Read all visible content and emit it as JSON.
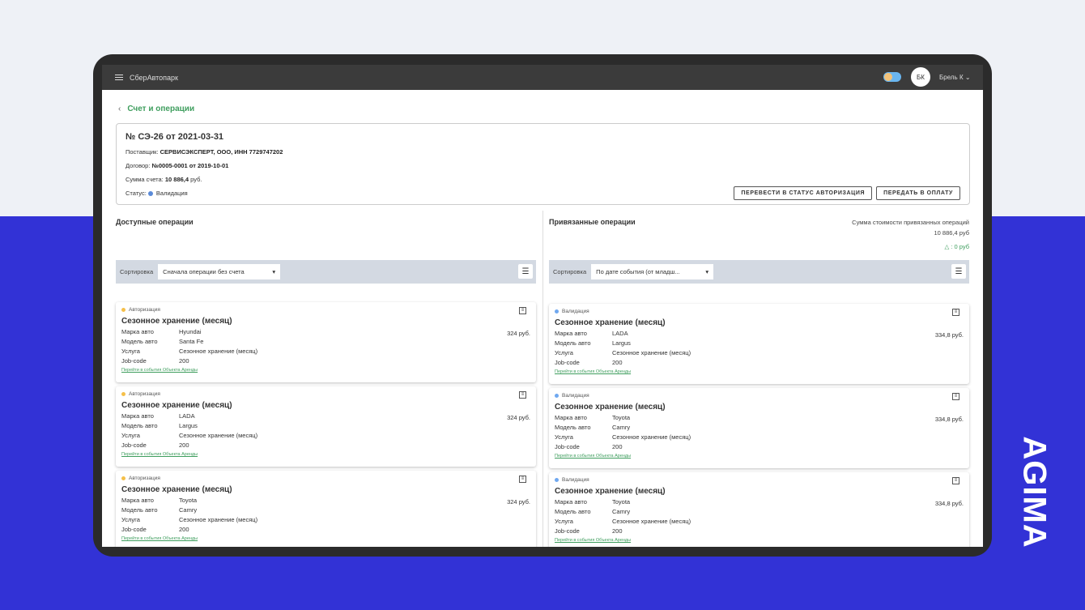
{
  "brand": "AGIMA",
  "app": {
    "title": "СберАвтопарк",
    "avatar": "БК",
    "user": "Брель К"
  },
  "back_label": "Счет и операции",
  "invoice": {
    "title": "№ СЭ-26 от 2021-03-31",
    "supplier_label": "Поставщик:",
    "supplier": "СЕРВИСЭКСПЕРТ, ООО, ИНН 7729747202",
    "contract_label": "Договор:",
    "contract": "№0005-0001 от 2019-10-01",
    "sum_label": "Сумма счета:",
    "sum": "10 886,4",
    "sum_unit": "руб.",
    "status_label": "Статус:",
    "status": "Валидация",
    "status_color": "#5a8ad8"
  },
  "buttons": {
    "authorize": "ПЕРЕВЕСТИ В СТАТУС АВТОРИЗАЦИЯ",
    "pay": "ПЕРЕДАТЬ В ОПЛАТУ"
  },
  "left": {
    "title": "Доступные операции",
    "sort_label": "Сортировка",
    "sort_value": "Сначала операции без счета",
    "cards": [
      {
        "status": "Авторизация",
        "color": "#f5c04a",
        "title": "Сезонное хранение (месяц)",
        "price": "324 руб.",
        "fields": [
          [
            "Марка авто",
            "Hyundai"
          ],
          [
            "Модель авто",
            "Santa Fe"
          ],
          [
            "Услуга",
            "Сезонное хранение (месяц)"
          ],
          [
            "Job-code",
            "200"
          ]
        ],
        "link": "Перейти в события Объекта Аренды"
      },
      {
        "status": "Авторизация",
        "color": "#f5c04a",
        "title": "Сезонное хранение (месяц)",
        "price": "324 руб.",
        "fields": [
          [
            "Марка авто",
            "LADA"
          ],
          [
            "Модель авто",
            "Largus"
          ],
          [
            "Услуга",
            "Сезонное хранение (месяц)"
          ],
          [
            "Job-code",
            "200"
          ]
        ],
        "link": "Перейти в события Объекта Аренды"
      },
      {
        "status": "Авторизация",
        "color": "#f5c04a",
        "title": "Сезонное хранение (месяц)",
        "price": "324 руб.",
        "fields": [
          [
            "Марка авто",
            "Toyota"
          ],
          [
            "Модель авто",
            "Camry"
          ],
          [
            "Услуга",
            "Сезонное хранение (месяц)"
          ],
          [
            "Job-code",
            "200"
          ]
        ],
        "link": "Перейти в события Объекта Аренды"
      }
    ]
  },
  "right": {
    "title": "Привязанные операции",
    "sum_label": "Сумма стоимости привязанных операций",
    "sum": "10 886,4 руб",
    "delta": ": 0 руб",
    "sort_label": "Сортировка",
    "sort_value": "По дате события (от младш...",
    "cards": [
      {
        "status": "Валидация",
        "color": "#6fa8f0",
        "title": "Сезонное хранение (месяц)",
        "price": "334,8 руб.",
        "fields": [
          [
            "Марка авто",
            "LADA"
          ],
          [
            "Модель авто",
            "Largus"
          ],
          [
            "Услуга",
            "Сезонное хранение (месяц)"
          ],
          [
            "Job-code",
            "200"
          ]
        ],
        "link": "Перейти в события Объекта Аренды"
      },
      {
        "status": "Валидация",
        "color": "#6fa8f0",
        "title": "Сезонное хранение (месяц)",
        "price": "334,8 руб.",
        "fields": [
          [
            "Марка авто",
            "Toyota"
          ],
          [
            "Модель авто",
            "Camry"
          ],
          [
            "Услуга",
            "Сезонное хранение (месяц)"
          ],
          [
            "Job-code",
            "200"
          ]
        ],
        "link": "Перейти в события Объекта Аренды"
      },
      {
        "status": "Валидация",
        "color": "#6fa8f0",
        "title": "Сезонное хранение (месяц)",
        "price": "334,8 руб.",
        "fields": [
          [
            "Марка авто",
            "Toyota"
          ],
          [
            "Модель авто",
            "Camry"
          ],
          [
            "Услуга",
            "Сезонное хранение (месяц)"
          ],
          [
            "Job-code",
            "200"
          ]
        ],
        "link": "Перейти в события Объекта Аренды"
      }
    ]
  }
}
